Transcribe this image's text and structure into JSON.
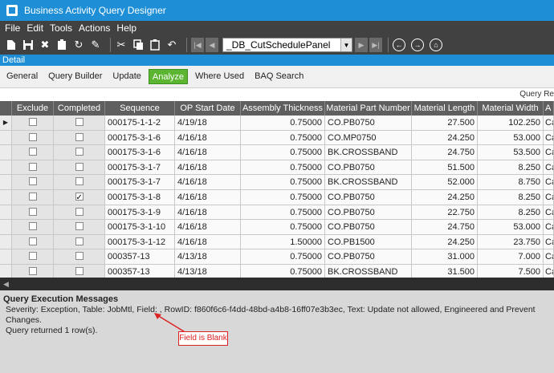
{
  "window": {
    "title": "Business Activity Query Designer"
  },
  "menu": [
    "File",
    "Edit",
    "Tools",
    "Actions",
    "Help"
  ],
  "toolbar": {
    "icons": [
      "new-icon",
      "save-icon",
      "delete-icon",
      "clipboard-icon",
      "refresh-icon",
      "clear-icon",
      "cut-icon",
      "copy-icon",
      "paste-icon",
      "undo-icon"
    ],
    "combo_value": "_DB_CutSchedulePanel"
  },
  "detail_label": "Detail",
  "tabs": [
    {
      "label": "General"
    },
    {
      "label": "Query Builder"
    },
    {
      "label": "Update"
    },
    {
      "label": "Analyze",
      "active": true
    },
    {
      "label": "Where Used"
    },
    {
      "label": "BAQ Search"
    }
  ],
  "results_label": "Query Re",
  "columns": [
    "Exclude",
    "Completed",
    "Sequence",
    "OP Start Date",
    "Assembly Thickness",
    "Material Part Number",
    "Material Length",
    "Material Width",
    "A"
  ],
  "rows": [
    {
      "exclude": false,
      "completed": false,
      "sequence": "000175-1-1-2",
      "op_start": "4/19/18",
      "thickness": "0.75000",
      "part": "CO.PB0750",
      "length": "27.500",
      "width": "102.250",
      "extra": "Ca"
    },
    {
      "exclude": false,
      "completed": false,
      "sequence": "000175-3-1-6",
      "op_start": "4/16/18",
      "thickness": "0.75000",
      "part": "CO.MP0750",
      "length": "24.250",
      "width": "53.000",
      "extra": "Ca"
    },
    {
      "exclude": false,
      "completed": false,
      "sequence": "000175-3-1-6",
      "op_start": "4/16/18",
      "thickness": "0.75000",
      "part": "BK.CROSSBAND",
      "length": "24.750",
      "width": "53.500",
      "extra": "Ca"
    },
    {
      "exclude": false,
      "completed": false,
      "sequence": "000175-3-1-7",
      "op_start": "4/16/18",
      "thickness": "0.75000",
      "part": "CO.PB0750",
      "length": "51.500",
      "width": "8.250",
      "extra": "Ca"
    },
    {
      "exclude": false,
      "completed": false,
      "sequence": "000175-3-1-7",
      "op_start": "4/16/18",
      "thickness": "0.75000",
      "part": "BK.CROSSBAND",
      "length": "52.000",
      "width": "8.750",
      "extra": "Ca"
    },
    {
      "exclude": false,
      "completed": true,
      "sequence": "000175-3-1-8",
      "op_start": "4/16/18",
      "thickness": "0.75000",
      "part": "CO.PB0750",
      "length": "24.250",
      "width": "8.250",
      "extra": "Ca"
    },
    {
      "exclude": false,
      "completed": false,
      "sequence": "000175-3-1-9",
      "op_start": "4/16/18",
      "thickness": "0.75000",
      "part": "CO.PB0750",
      "length": "22.750",
      "width": "8.250",
      "extra": "Ca"
    },
    {
      "exclude": false,
      "completed": false,
      "sequence": "000175-3-1-10",
      "op_start": "4/16/18",
      "thickness": "0.75000",
      "part": "CO.PB0750",
      "length": "24.750",
      "width": "53.000",
      "extra": "Ca"
    },
    {
      "exclude": false,
      "completed": false,
      "sequence": "000175-3-1-12",
      "op_start": "4/16/18",
      "thickness": "1.50000",
      "part": "CO.PB1500",
      "length": "24.250",
      "width": "23.750",
      "extra": "Ca"
    },
    {
      "exclude": false,
      "completed": false,
      "sequence": "000357-13",
      "op_start": "4/13/18",
      "thickness": "0.75000",
      "part": "CO.PB0750",
      "length": "31.000",
      "width": "7.000",
      "extra": "Ca"
    },
    {
      "exclude": false,
      "completed": false,
      "sequence": "000357-13",
      "op_start": "4/13/18",
      "thickness": "0.75000",
      "part": "BK.CROSSBAND",
      "length": "31.500",
      "width": "7.500",
      "extra": "Ca"
    }
  ],
  "messages": {
    "title": "Query Execution Messages",
    "line1": "Severity: Exception, Table: JobMtl, Field: , RowID: f860f6c6-f4dd-48bd-a4b8-16ff07e3b3ec, Text: Update not allowed, Engineered and Prevent Changes.",
    "line2": "Query returned 1 row(s)."
  },
  "annotation": {
    "text": "Field is Blank",
    "color": "#d22222"
  }
}
